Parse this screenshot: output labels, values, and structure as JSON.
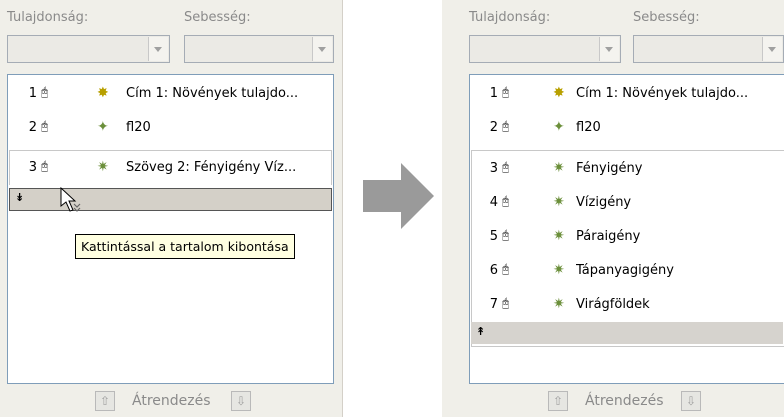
{
  "labels": {
    "property": "Tulajdonság:",
    "speed": "Sebesség:",
    "reorder": "Átrendezés"
  },
  "icons": {
    "mouse": "🖰",
    "effect_star": "✸",
    "effect_burst": "✦",
    "effect_fly": "✷",
    "expand": "⌄",
    "collapse": "⌃",
    "move_up": "⇧",
    "move_down": "⇩",
    "big_arrow": "arrow-right",
    "cursor": "pointer-with-expand"
  },
  "before": {
    "items": [
      {
        "num": "1",
        "text": "Cím 1: Növények tulajdo..."
      },
      {
        "num": "2",
        "text": "fl20"
      },
      {
        "num": "3",
        "text": "Szöveg 2: Fényigény Víz..."
      }
    ],
    "tooltip": "Kattintással a tartalom kibontása"
  },
  "after": {
    "items": [
      {
        "num": "1",
        "text": "Cím 1: Növények tulajdo..."
      },
      {
        "num": "2",
        "text": "fl20"
      },
      {
        "num": "3",
        "text": "Fényigény"
      },
      {
        "num": "4",
        "text": "Vízigény"
      },
      {
        "num": "5",
        "text": "Páraigény"
      },
      {
        "num": "6",
        "text": "Tápanyagigény"
      },
      {
        "num": "7",
        "text": "Virágföldek"
      }
    ]
  },
  "colors": {
    "panel_bg": "#f0efe9",
    "list_border": "#7f9db9",
    "tooltip_bg": "#ffffe1",
    "expander_bg": "#d4d0c8",
    "arrow_gray": "#9a9a9a"
  }
}
